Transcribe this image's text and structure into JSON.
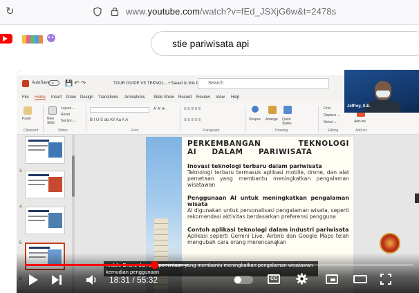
{
  "browser": {
    "url_prefix": "www.",
    "url_domain": "youtube.com",
    "url_path": "/watch?v=fEd_JSXjG6w&t=2478s"
  },
  "youtube": {
    "search_query": "stie pariwisata api"
  },
  "powerpoint": {
    "autosave": "AutoSave",
    "autosave_state": "Off",
    "doc_title": "TOUR GUIDE VS TEKNOL... • Saved to this PC ⌄",
    "search_placeholder": "Search",
    "menu": [
      "File",
      "Home",
      "Insert",
      "Draw",
      "Design",
      "Transitions",
      "Animations",
      "Slide Show",
      "Record",
      "Review",
      "View",
      "Help"
    ],
    "active_menu": "Home",
    "ribbon": {
      "paste": "Paste",
      "new_slide": "New\nSlide",
      "layout": "Layout ⌄",
      "reset": "Reset",
      "section": "Section ⌄",
      "shapes": "Shapes",
      "arrange": "Arrange",
      "quick_styles": "Quick\nStyles",
      "find": "Find",
      "replace": "Replace ⌄",
      "select": "Select ⌄",
      "addins": "Add-ins",
      "groups": [
        "Clipboard",
        "Slides",
        "Font",
        "Paragraph",
        "Drawing",
        "Editing",
        "Add-ins"
      ]
    },
    "thumb_numbers": [
      "3",
      "4",
      "5",
      "6"
    ],
    "slide": {
      "title": "PERKEMBANGAN TEKNOLOGI AI DALAM PARIWISATA",
      "sections": [
        {
          "heading": "Inovasi teknologi terbaru dalam pariwisata",
          "body": "Teknologi terbaru termasuk aplikasi mobile, drone, dan alat pemetaan yang membantu meningkatkan pengalaman wisatawan"
        },
        {
          "heading": "Penggunaan AI untuk meningkatkan pengalaman wisata",
          "body": "AI digunakan untuk personalisasi pengalaman wisata, seperti rekomendasi aktivitas berdasarkan preferensi pengguna"
        },
        {
          "heading": "Contoh aplikasi teknologi dalam industri pariwisata",
          "body": "Aplikasi seperti Gemini Live, Airbnb dan Google Maps telah mengubah cara orang merencanakan"
        }
      ]
    }
  },
  "webcam": {
    "name": "Jeffrey, S.E."
  },
  "caption": {
    "text": "mobile Drone dan alat pemintaan yang membantu meningkatkan pengalaman wisatawan kemudian penggunaan"
  },
  "player": {
    "current_time": "18:31",
    "duration": "55:32",
    "played_fraction": 0.333,
    "loaded_fraction": 0.42,
    "cc_label": "CC"
  },
  "colors": {
    "youtube_red": "#ff0000",
    "ppt_accent": "#c43e1c"
  }
}
